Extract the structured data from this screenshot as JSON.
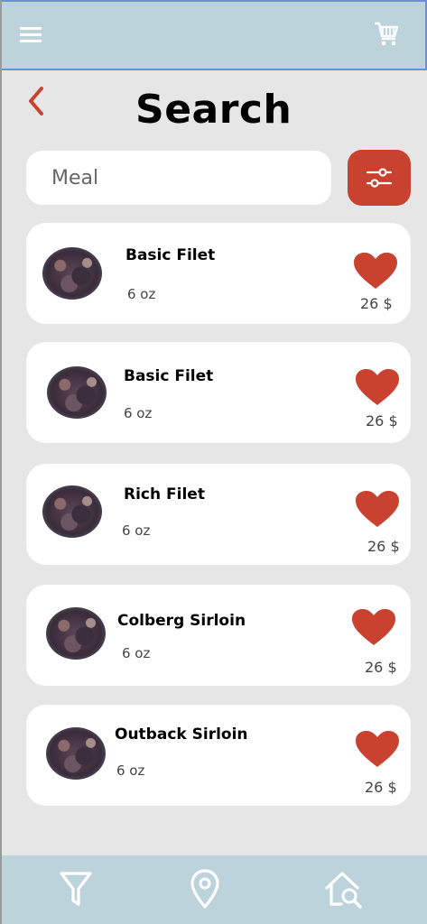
{
  "header": {
    "title": "Search"
  },
  "search": {
    "placeholder": "Meal"
  },
  "colors": {
    "accent": "#c9412f",
    "bar": "#bcd3dc",
    "background": "#e6e6e6"
  },
  "icons": [
    "menu-icon",
    "cart-icon",
    "back-icon",
    "filter-sliders-icon",
    "heart-icon",
    "funnel-icon",
    "location-pin-icon",
    "home-search-icon"
  ],
  "items": [
    {
      "name": "Basic Filet",
      "size": "6 oz",
      "price": "26 $"
    },
    {
      "name": "Basic Filet",
      "size": "6 oz",
      "price": "26 $"
    },
    {
      "name": "Rich Filet",
      "size": "6 oz",
      "price": "26 $"
    },
    {
      "name": "Colberg Sirloin",
      "size": "6 oz",
      "price": "26 $"
    },
    {
      "name": "Outback Sirloin",
      "size": "6 oz",
      "price": "26 $"
    }
  ]
}
